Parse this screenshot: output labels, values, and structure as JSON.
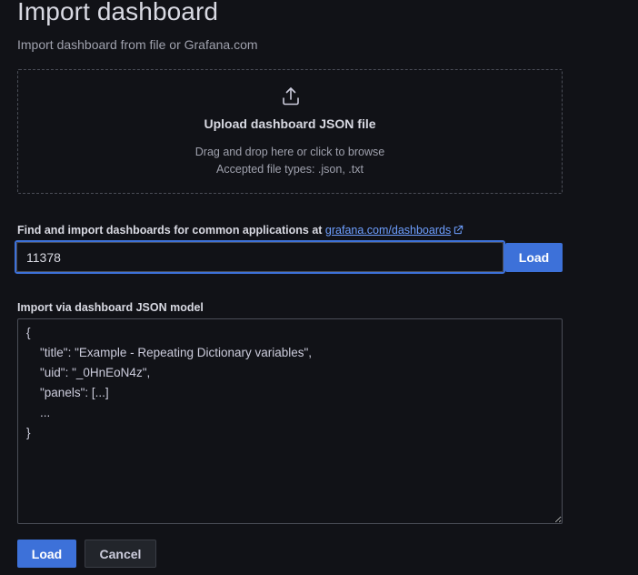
{
  "header": {
    "title": "Import dashboard",
    "subtitle": "Import dashboard from file or Grafana.com"
  },
  "upload": {
    "icon": "upload-icon",
    "title": "Upload dashboard JSON file",
    "hint": "Drag and drop here or click to browse",
    "accepted_types": "Accepted file types: .json, .txt"
  },
  "grafana_com": {
    "label_prefix": "Find and import dashboards for common applications at ",
    "link_text": "grafana.com/dashboards",
    "link_icon": "external-link-icon",
    "input_value": "11378",
    "load_label": "Load"
  },
  "json_model": {
    "label": "Import via dashboard JSON model",
    "content": "{\n    \"title\": \"Example - Repeating Dictionary variables\",\n    \"uid\": \"_0HnEoN4z\",\n    \"panels\": [...]\n    ...\n}"
  },
  "actions": {
    "load_label": "Load",
    "cancel_label": "Cancel"
  },
  "colors": {
    "background": "#111217",
    "primary": "#3d71d9",
    "link": "#6e9fff"
  }
}
